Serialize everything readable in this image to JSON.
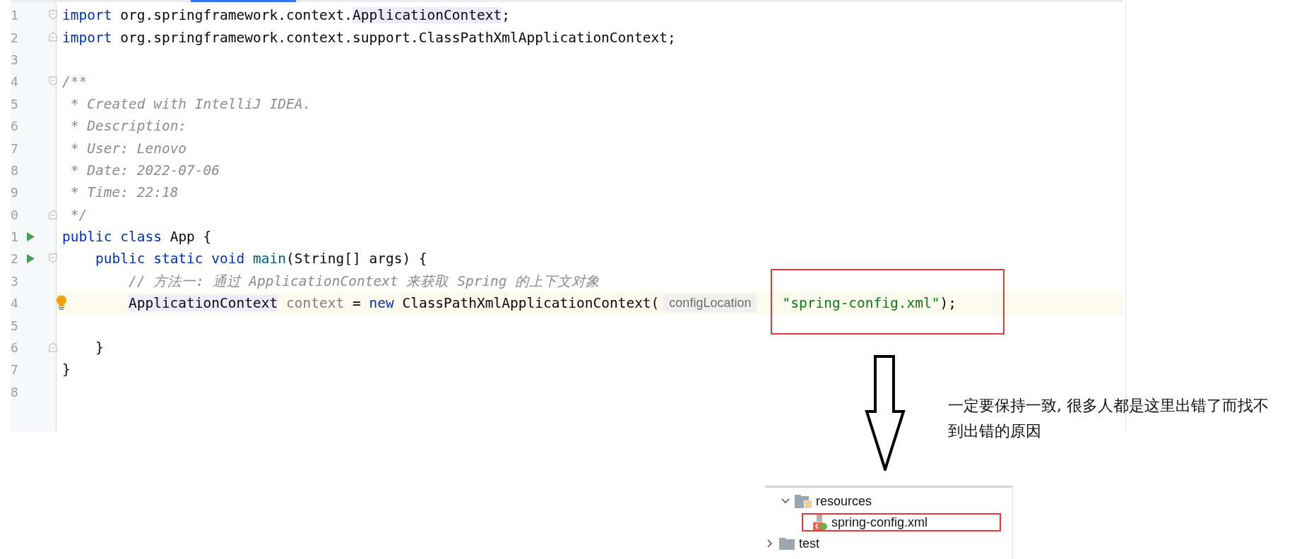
{
  "editor": {
    "lines": [
      {
        "number": "1",
        "fold_start": true,
        "tokens": [
          {
            "kind": "keyword",
            "text": "import"
          },
          {
            "kind": "plain",
            "text": " org.springframework.context."
          },
          {
            "kind": "type-ref",
            "text": "ApplicationContext"
          },
          {
            "kind": "plain",
            "text": ";"
          }
        ]
      },
      {
        "number": "2",
        "fold_end": true,
        "tokens": [
          {
            "kind": "keyword",
            "text": "import"
          },
          {
            "kind": "plain",
            "text": " org.springframework.context.support.ClassPathXmlApplicationContext;"
          }
        ]
      },
      {
        "number": "3"
      },
      {
        "number": "4",
        "fold_start": true,
        "tokens": [
          {
            "kind": "comment",
            "text": "/**"
          }
        ]
      },
      {
        "number": "5",
        "tokens": [
          {
            "kind": "comment",
            "text": " * Created with IntelliJ IDEA."
          }
        ]
      },
      {
        "number": "6",
        "tokens": [
          {
            "kind": "comment",
            "text": " * Description:"
          }
        ]
      },
      {
        "number": "7",
        "tokens": [
          {
            "kind": "comment",
            "text": " * User: Lenovo"
          }
        ]
      },
      {
        "number": "8",
        "tokens": [
          {
            "kind": "comment",
            "text": " * Date: 2022-07-06"
          }
        ]
      },
      {
        "number": "9",
        "tokens": [
          {
            "kind": "comment",
            "text": " * Time: 22:18"
          }
        ]
      },
      {
        "number": "0",
        "fold_end": true,
        "tokens": [
          {
            "kind": "comment",
            "text": " */"
          }
        ]
      },
      {
        "number": "1",
        "run": true,
        "tokens": [
          {
            "kind": "keyword",
            "text": "public class"
          },
          {
            "kind": "plain",
            "text": " App {"
          }
        ]
      },
      {
        "number": "2",
        "fold_start": true,
        "run": true,
        "tokens": [
          {
            "kind": "keyword",
            "text": "    public static void"
          },
          {
            "kind": "method",
            "text": " main"
          },
          {
            "kind": "plain",
            "text": "(String[] args) {"
          }
        ]
      },
      {
        "number": "3",
        "tokens": [
          {
            "kind": "comment",
            "text": "        // 方法一: 通过 ApplicationContext 来获取 Spring 的上下文对象"
          }
        ]
      },
      {
        "number": "4",
        "highlighted": true,
        "bulb": true,
        "tokens": [
          {
            "kind": "type-ref",
            "text": "        ApplicationContext"
          },
          {
            "kind": "unused",
            "text": " context"
          },
          {
            "kind": "plain",
            "text": " = "
          },
          {
            "kind": "keyword",
            "text": "new"
          },
          {
            "kind": "plain",
            "text": " ClassPathXmlApplicationContext("
          },
          {
            "kind": "hint",
            "text": "configLocation"
          },
          {
            "kind": "string",
            "text": "\"spring-config.xml\""
          },
          {
            "kind": "plain",
            "text": ");"
          }
        ]
      },
      {
        "number": "5"
      },
      {
        "number": "6",
        "fold_end": true,
        "tokens": [
          {
            "kind": "plain",
            "text": "    }"
          }
        ]
      },
      {
        "number": "7",
        "tokens": [
          {
            "kind": "plain",
            "text": "}"
          }
        ]
      },
      {
        "number": "8"
      }
    ]
  },
  "note": "一定要保持一致, 很多人都是这里出错了而找不到出错的原因",
  "project_tree": {
    "items": [
      {
        "label": "resources",
        "kind": "resources-folder",
        "expanded": true,
        "children": [
          {
            "label": "spring-config.xml",
            "kind": "xml-file",
            "marked": true
          }
        ]
      },
      {
        "label": "test",
        "kind": "folder",
        "expanded": false
      }
    ]
  }
}
